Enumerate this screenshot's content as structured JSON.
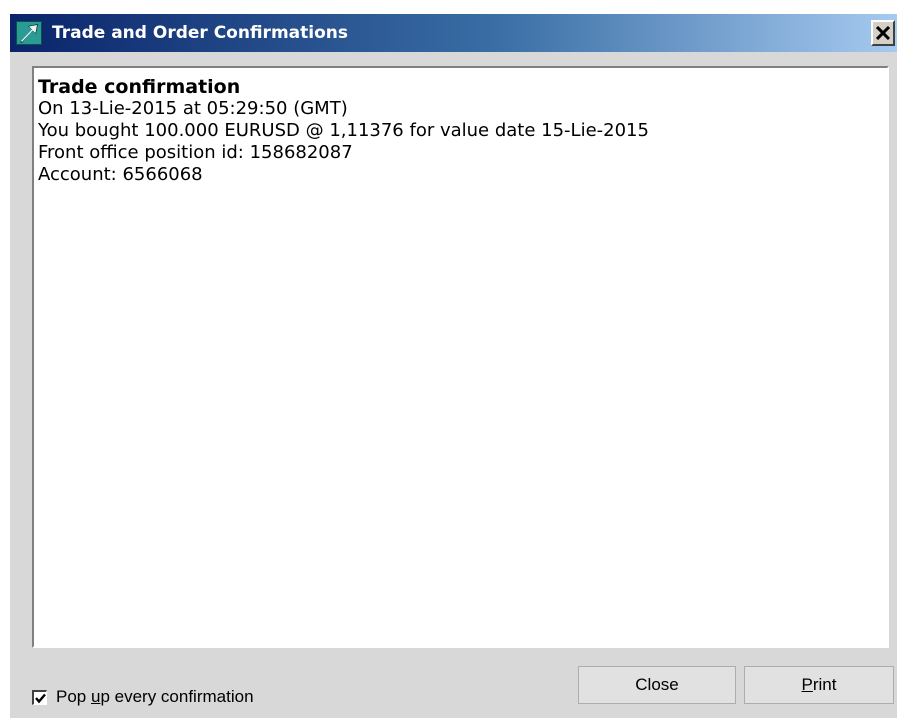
{
  "window": {
    "title": "Trade and Order Confirmations"
  },
  "content": {
    "heading": "Trade confirmation",
    "lines": [
      "On 13-Lie-2015 at 05:29:50 (GMT)",
      "You bought 100.000 EURUSD @ 1,11376 for value date 15-Lie-2015",
      "Front office position id: 158682087",
      "Account: 6566068"
    ]
  },
  "footer": {
    "checkbox": {
      "label_before": "Pop ",
      "label_accel": "u",
      "label_after": "p every confirmation",
      "checked": true
    },
    "close_label": "Close",
    "print_accel": "P",
    "print_rest": "rint"
  },
  "colors": {
    "title_gradient_start": "#0a246a",
    "title_gradient_end": "#a6caf0",
    "dialog_background": "#d8d8d8",
    "icon_color": "#2b9b96"
  },
  "icons": {
    "app": "arrow-up-right-icon",
    "close": "close-icon",
    "check": "checkmark-icon"
  }
}
